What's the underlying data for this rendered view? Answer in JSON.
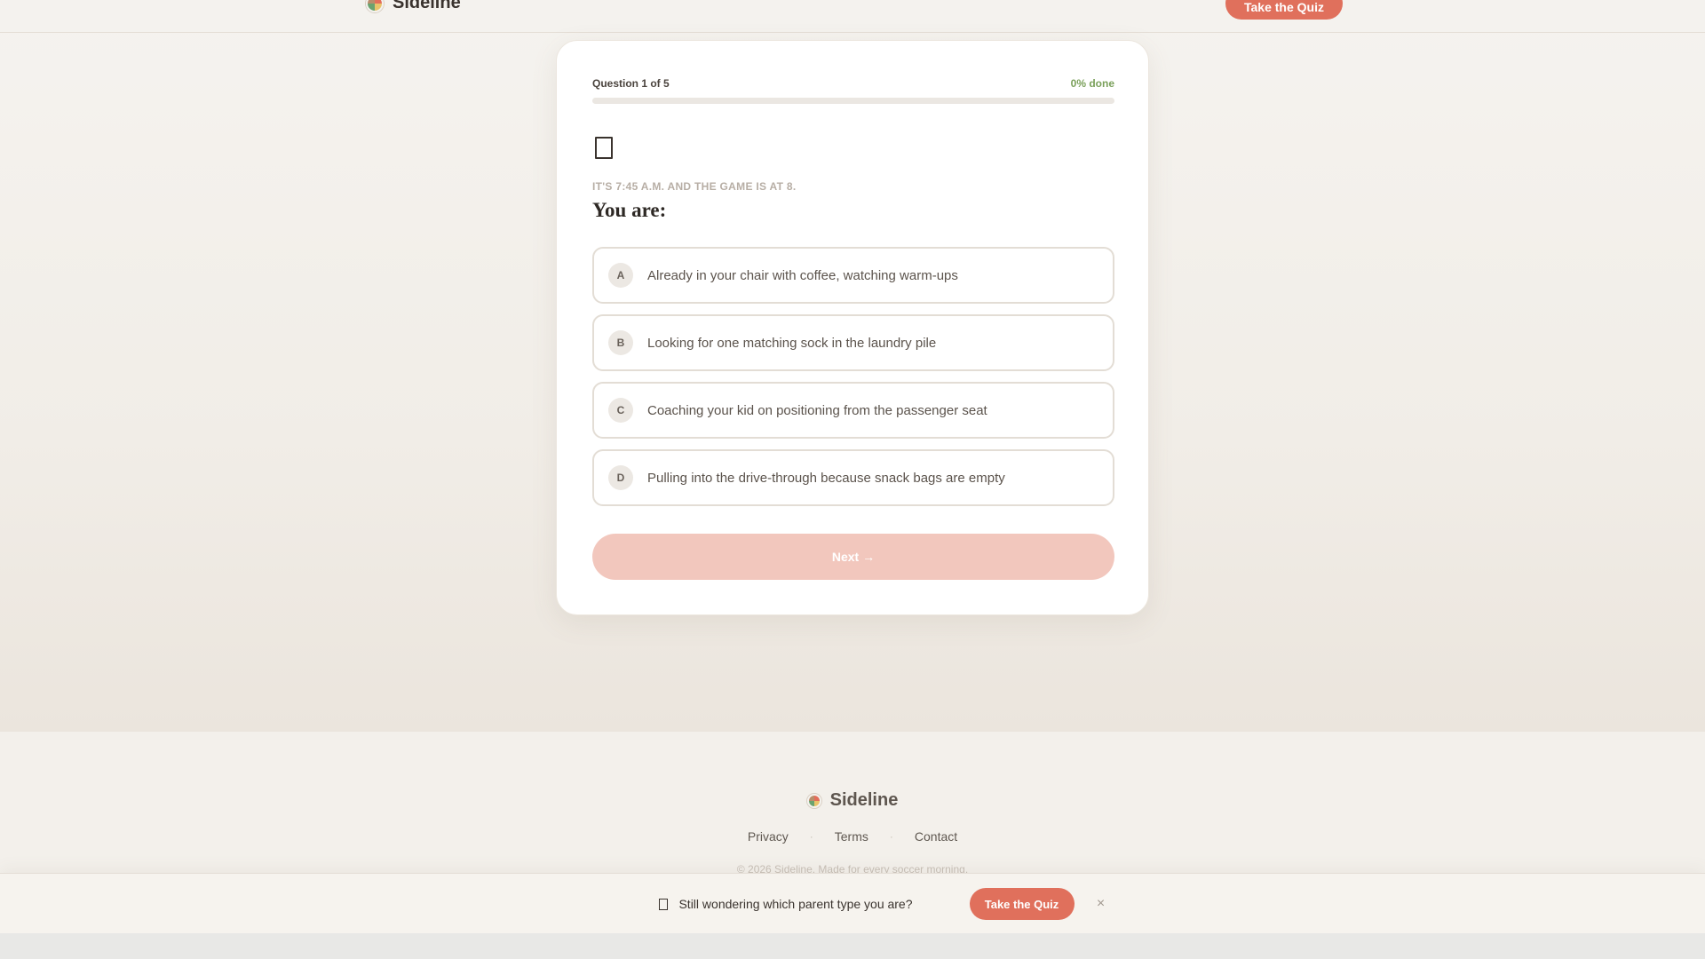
{
  "header": {
    "brand": "Sideline",
    "cta_label": "Take the Quiz"
  },
  "quiz": {
    "question_counter": "Question 1 of 5",
    "progress_label": "0% done",
    "progress_fraction": 0,
    "question_icon": "card-icon",
    "kicker": "IT'S 7:45 A.M. AND THE GAME IS AT 8.",
    "prompt": "You are:",
    "options": [
      {
        "letter": "A",
        "text": "Already in your chair with coffee, watching warm-ups"
      },
      {
        "letter": "B",
        "text": "Looking for one matching sock in the laundry pile"
      },
      {
        "letter": "C",
        "text": "Coaching your kid on positioning from the passenger seat"
      },
      {
        "letter": "D",
        "text": "Pulling into the drive-through because snack bags are empty"
      }
    ],
    "next_label": "Next →"
  },
  "footer": {
    "brand": "Sideline",
    "links": [
      "Privacy",
      "Terms",
      "Contact"
    ],
    "separator": "·",
    "copyright": "© 2026 Sideline. Made for every soccer morning."
  },
  "banner": {
    "text": "Still wondering which parent type you are?",
    "cta_label": "Take the Quiz",
    "close_glyph": "×"
  },
  "colors": {
    "accent": "#e0705c",
    "progress": "#7aa05a",
    "next_disabled": "#f2c7bd"
  }
}
